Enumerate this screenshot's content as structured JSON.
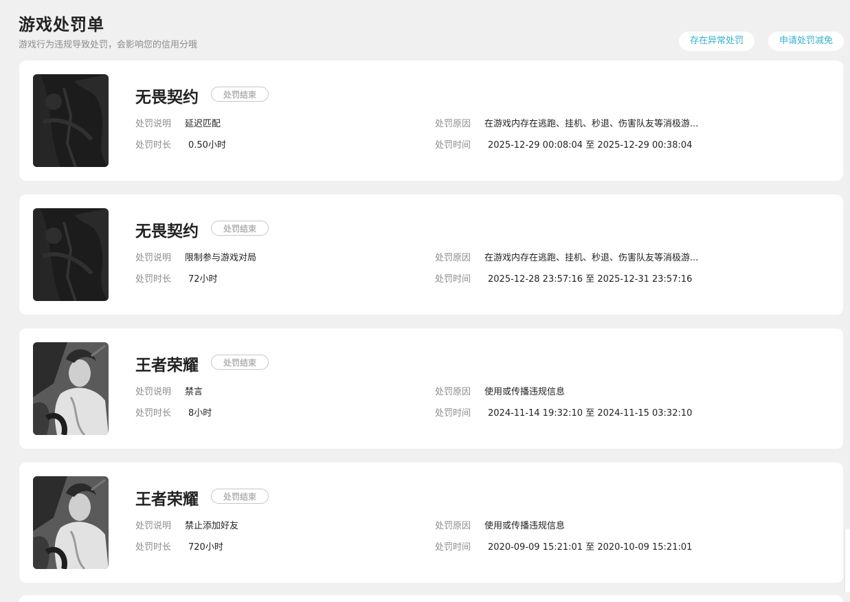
{
  "page": {
    "title": "游戏处罚单",
    "subtitle": "游戏行为违规导致处罚，会影响您的信用分哦"
  },
  "actions": {
    "abnormal_label": "存在异常处罚",
    "reduce_label": "申请处罚减免"
  },
  "labels": {
    "desc": "处罚说明",
    "duration": "处罚时长",
    "reason": "处罚原因",
    "time": "处罚时间"
  },
  "colors": {
    "accent": "#2fb3d6",
    "background": "#f0f0f0"
  },
  "cards": [
    {
      "game": "无畏契约",
      "status": "处罚结束",
      "desc": "延迟匹配",
      "duration": "0.50小时",
      "reason": "在游戏内存在逃跑、挂机、秒退、伤害队友等消极游...",
      "time": "2025-12-29 00:08:04 至 2025-12-29 00:38:04",
      "image": "valorant-cover-image"
    },
    {
      "game": "无畏契约",
      "status": "处罚结束",
      "desc": "限制参与游戏对局",
      "duration": "72小时",
      "reason": "在游戏内存在逃跑、挂机、秒退、伤害队友等消极游...",
      "time": "2025-12-28 23:57:16 至 2025-12-31 23:57:16",
      "image": "valorant-cover-image"
    },
    {
      "game": "王者荣耀",
      "status": "处罚结束",
      "desc": "禁言",
      "duration": "8小时",
      "reason": "使用或传播违规信息",
      "time": "2024-11-14 19:32:10 至 2024-11-15 03:32:10",
      "image": "honor-of-kings-hero-image"
    },
    {
      "game": "王者荣耀",
      "status": "处罚结束",
      "desc": "禁止添加好友",
      "duration": "720小时",
      "reason": "使用或传播违规信息",
      "time": "2020-09-09 15:21:01 至 2020-10-09 15:21:01",
      "image": "honor-of-kings-hero-image"
    }
  ]
}
